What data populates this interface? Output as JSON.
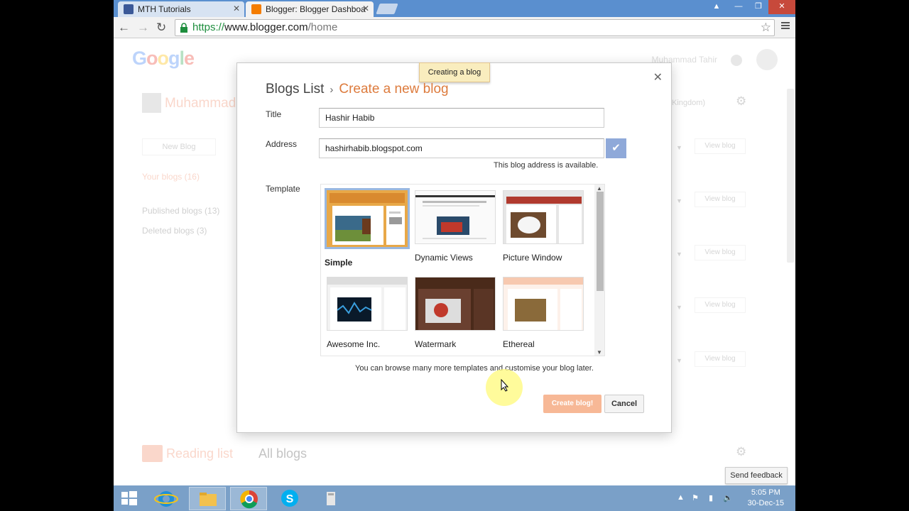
{
  "browser": {
    "tabs": [
      {
        "title": "MTH Tutorials",
        "favicon_color": "#3b5998"
      },
      {
        "title": "Blogger: Blogger Dashboa",
        "favicon_color": "#f57d00"
      }
    ],
    "url": {
      "proto": "https://",
      "host": "www.blogger.com",
      "path": "/home"
    }
  },
  "background": {
    "logo": "Google",
    "user_name_top": "Muhammad Tahir",
    "user_name": "Muhammad",
    "new_blog": "New Blog",
    "your_blogs": "Your blogs (16)",
    "published": "Published blogs (13)",
    "deleted": "Deleted blogs (3)",
    "kingdom": "Kingdom)",
    "view_blog": "View blog",
    "reading_list": "Reading list",
    "all_blogs": "All blogs",
    "send_feedback": "Send feedback"
  },
  "modal": {
    "toast": "Creating a blog",
    "crumb_root": "Blogs List",
    "crumb_sep": "›",
    "crumb_current": "Create a new blog",
    "title_label": "Title",
    "title_value": "Hashir Habib",
    "address_label": "Address",
    "address_value": "hashirhabib.blogspot.com",
    "address_status": "This blog address is available.",
    "template_label": "Template",
    "templates": [
      "Simple",
      "Dynamic Views",
      "Picture Window",
      "Awesome Inc.",
      "Watermark",
      "Ethereal"
    ],
    "hint": "You can browse many more templates and customise your blog later.",
    "create_label": "Create blog!",
    "cancel_label": "Cancel"
  },
  "taskbar": {
    "time": "5:05 PM",
    "date": "30-Dec-15"
  },
  "colors": {
    "accent_orange": "#dd7b3d",
    "chrome_blue": "#5a8fcf",
    "check_blue": "#8fa9d9",
    "create_btn": "#f7b896"
  }
}
